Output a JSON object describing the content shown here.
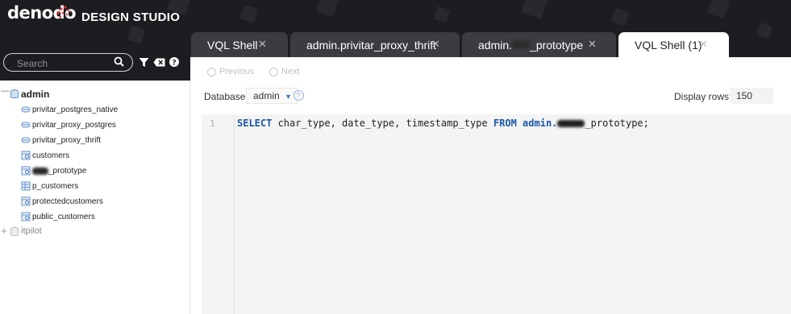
{
  "header": {
    "logo": "denodo",
    "product": "DESIGN STUDIO"
  },
  "search": {
    "placeholder": "Search"
  },
  "tabs": [
    {
      "label": "VQL Shell",
      "active": false
    },
    {
      "label": "admin.privitar_proxy_thrift",
      "active": false
    },
    {
      "label": "admin.",
      "label_suffix": "_prototype",
      "active": false
    },
    {
      "label": "VQL Shell (1)",
      "active": true
    }
  ],
  "tree": {
    "databases": [
      {
        "label": "admin",
        "expanded": true,
        "items": [
          {
            "label": "privitar_postgres_native",
            "icon": "datasource-icon"
          },
          {
            "label": "privitar_proxy_postgres",
            "icon": "datasource-icon"
          },
          {
            "label": "privitar_proxy_thrift",
            "icon": "datasource-icon"
          },
          {
            "label": "customers",
            "icon": "derived-view-icon"
          },
          {
            "label": "_prototype",
            "icon": "derived-view-icon",
            "redacted_prefix": true
          },
          {
            "label": "p_customers",
            "icon": "base-view-icon"
          },
          {
            "label": "protectedcustomers",
            "icon": "derived-view-icon"
          },
          {
            "label": "public_customers",
            "icon": "derived-view-icon"
          }
        ]
      },
      {
        "label": "itpilot",
        "expanded": false
      }
    ]
  },
  "toolbar": {
    "previous": "Previous",
    "next": "Next",
    "database_label": "Database",
    "database_value": "admin",
    "display_rows_label": "Display rows",
    "display_rows_value": "150"
  },
  "editor": {
    "line_number": "1",
    "tokens": [
      {
        "text": "SELECT",
        "kw": true
      },
      {
        "text": " char_type, date_type, timestamp_type ",
        "kw": false
      },
      {
        "text": "FROM",
        "kw": true
      },
      {
        "text": " ",
        "kw": false
      },
      {
        "text": "admin.",
        "kw": true
      },
      {
        "text": "_prototype;",
        "kw": false
      }
    ]
  },
  "colors": {
    "header_bg": "#1c1d20",
    "tab_bg": "#3a3c41",
    "keyword": "#1a57a7",
    "editor_bg": "#f4f4f4"
  }
}
